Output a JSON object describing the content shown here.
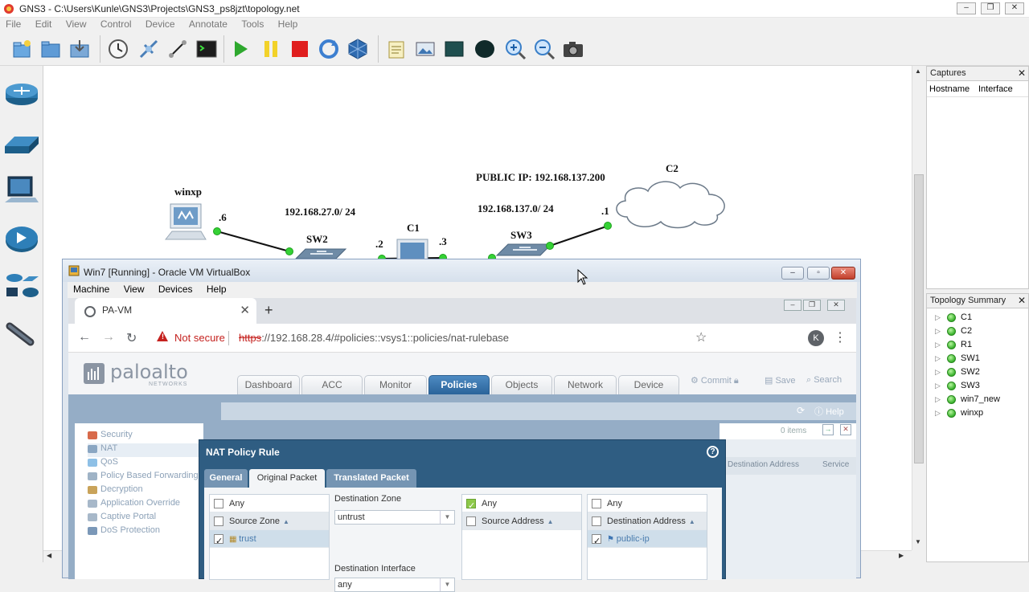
{
  "gns3": {
    "title": "GNS3 - C:\\Users\\Kunle\\GNS3\\Projects\\GNS3_ps8jzt\\topology.net",
    "menu": [
      "File",
      "Edit",
      "View",
      "Control",
      "Device",
      "Annotate",
      "Tools",
      "Help"
    ],
    "toolbar_icons": [
      "new-project-icon",
      "open-project-icon",
      "save-project-icon",
      "snapshot-icon",
      "browse-devices-icon",
      "draw-link-icon",
      "console-icon",
      "start-icon",
      "pause-icon",
      "stop-icon",
      "reload-icon",
      "virtualbox-icon",
      "note-icon",
      "picture-icon",
      "rectangle-icon",
      "ellipse-icon",
      "zoom-in-icon",
      "zoom-out-icon",
      "screenshot-icon"
    ],
    "device_icons": [
      "router-icon",
      "switch-icon",
      "end-device-icon",
      "security-device-icon",
      "all-devices-icon",
      "link-icon"
    ]
  },
  "topology": {
    "public_ip_label": "PUBLIC IP: 192.168.137.200",
    "net1_label": "192.168.27.0/ 24",
    "net2_label": "192.168.137.0/ 24",
    "nodes": {
      "winxp": "winxp",
      "sw2": "SW2",
      "c1": "C1",
      "sw3": "SW3",
      "c2": "C2"
    },
    "iface_labels": {
      "winxp_if": ".6",
      "sw2_c1": ".2",
      "c1_sw3": ".3",
      "c2_if": ".1"
    }
  },
  "captures": {
    "title": "Captures",
    "columns": [
      "Hostname",
      "Interface"
    ]
  },
  "topology_summary": {
    "title": "Topology Summary",
    "items": [
      "C1",
      "C2",
      "R1",
      "SW1",
      "SW2",
      "SW3",
      "win7_new",
      "winxp"
    ]
  },
  "virtualbox": {
    "title": "Win7 [Running] - Oracle VM VirtualBox",
    "menu": [
      "Machine",
      "View",
      "Devices",
      "Help"
    ]
  },
  "browser": {
    "tab_title": "PA-VM",
    "not_secure": "Not secure",
    "url_scheme": "https",
    "url_rest": "://192.168.28.4/#policies::vsys1::policies/nat-rulebase",
    "profile_initial": "K"
  },
  "paloalto": {
    "logo_text": "paloalto",
    "logo_sub": "NETWORKS",
    "tabs": [
      "Dashboard",
      "ACC",
      "Monitor",
      "Policies",
      "Objects",
      "Network",
      "Device"
    ],
    "active_tab": "Policies",
    "commit": "Commit",
    "save": "Save",
    "search": "Search",
    "help": "Help",
    "items_count": "0 items",
    "sidebar": [
      "Security",
      "NAT",
      "QoS",
      "Policy Based Forwarding",
      "Decryption",
      "Application Override",
      "Captive Portal",
      "DoS Protection"
    ],
    "right_columns": [
      "Destination Address",
      "Service"
    ]
  },
  "nat_dialog": {
    "title": "NAT Policy Rule",
    "tabs": [
      "General",
      "Original Packet",
      "Translated Packet"
    ],
    "active_tab": "Original Packet",
    "source_zone": {
      "any": "Any",
      "header": "Source Zone",
      "items": [
        "trust"
      ]
    },
    "destination_zone": {
      "label": "Destination Zone",
      "value": "untrust"
    },
    "destination_interface": {
      "label": "Destination Interface",
      "value": "any"
    },
    "source_address": {
      "any": "Any",
      "any_checked": true,
      "header": "Source Address"
    },
    "destination_address": {
      "any": "Any",
      "header": "Destination Address",
      "items": [
        "public-ip"
      ]
    }
  },
  "colors": {
    "pa_accent": "#2b649a",
    "nat_dialog_bg": "#2f5d82",
    "link_dot": "#35d135",
    "not_secure": "#c5221f"
  }
}
